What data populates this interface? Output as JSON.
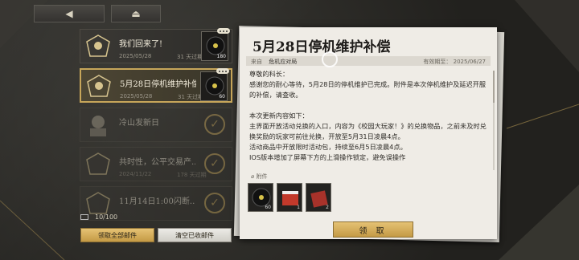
{
  "nav": {
    "back_icon": "back-arrow-icon",
    "home_icon": "eject-icon"
  },
  "mail_list": [
    {
      "title": "我们回来了!",
      "date": "2025/05/28",
      "expiry": "31 天过期",
      "attachment_count": "180",
      "state": "unread"
    },
    {
      "title": "5月28日停机维护补偿",
      "date": "2025/05/28",
      "expiry": "31 天过期",
      "attachment_count": "60",
      "state": "selected"
    },
    {
      "title": "冷山发新日",
      "date": "",
      "expiry": "",
      "state": "read"
    },
    {
      "title": "共时性，公平交易产...",
      "date": "2024/11/22",
      "expiry": "178 天过期",
      "state": "read"
    },
    {
      "title": "11月14日1:00闪断...",
      "date": "",
      "expiry": "",
      "state": "read"
    }
  ],
  "footer": {
    "mail_count": "10/100",
    "claim_all": "领取全部邮件",
    "clear_read": "清空已收邮件"
  },
  "detail": {
    "title": "5月28日停机维护补偿",
    "from_label": "来自",
    "from": "危机应对局",
    "expiry_label": "有效期至：",
    "expiry": "2025/06/27",
    "body": "尊敬的科长：\n感谢您的耐心等待，5月28日的停机维护已完成。附件是本次停机维护及延迟开服的补偿，请查收。\n\n本次更新内容如下：\n主界面开放活动兑换的入口，内容为《校园大玩家！》的兑换物品，之前未及时兑换奖励的玩家可前往兑换，开放至5月31日凌晨4点。\n活动商品中开放限时活动包，持续至6月5日凌晨4点。\nIOS版本增加了屏幕下方的上滑操作锁定，避免误操作",
    "attachments_label": "附件",
    "rewards": [
      {
        "name": "record-disc",
        "count": "60"
      },
      {
        "name": "red-ticket-box",
        "count": "1"
      },
      {
        "name": "red-supply-box",
        "count": "2"
      }
    ],
    "claim_button": "领 取"
  },
  "colors": {
    "accent_gold": "#c7a65a",
    "paper": "#efece6",
    "bg": "#2b2a27"
  }
}
